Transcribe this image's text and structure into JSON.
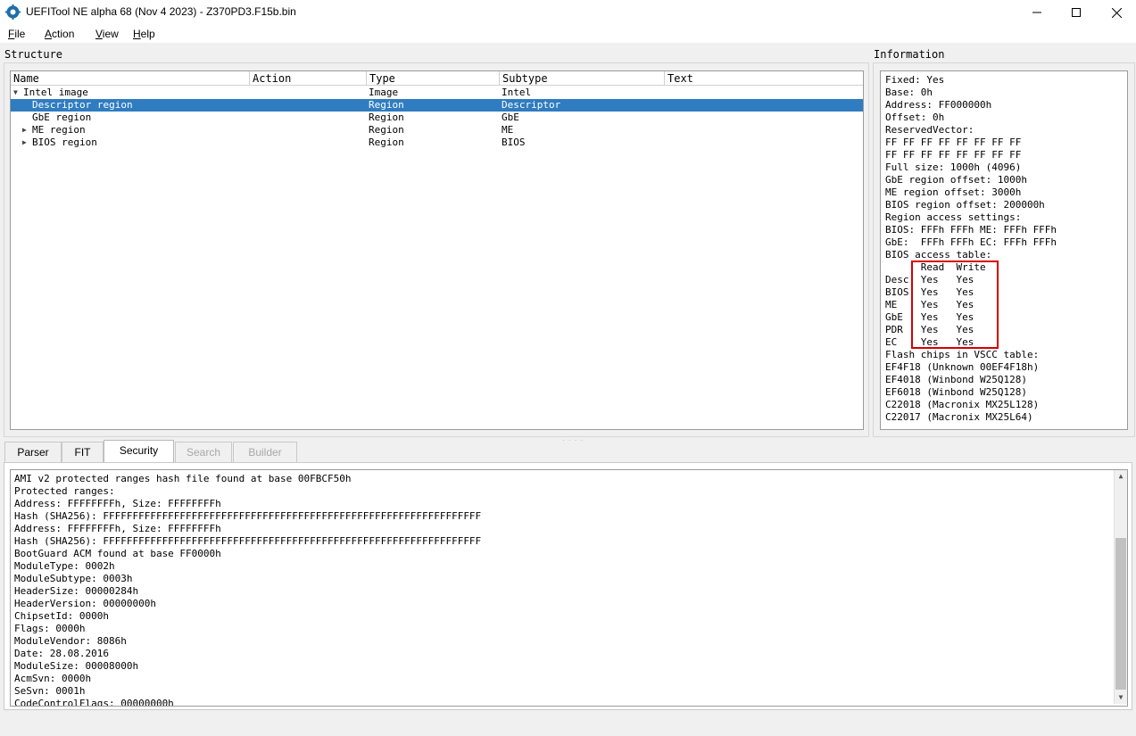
{
  "window": {
    "title": "UEFITool NE alpha 68 (Nov  4 2023) - Z370PD3.F15b.bin",
    "minimize": "—",
    "maximize": "☐",
    "close": "✕"
  },
  "menu": [
    {
      "key": "F",
      "rest": "ile"
    },
    {
      "key": "A",
      "rest": "ction"
    },
    {
      "key": "V",
      "rest": "iew"
    },
    {
      "key": "H",
      "rest": "elp"
    }
  ],
  "structure": {
    "label": "Structure",
    "columns": [
      "Name",
      "Action",
      "Type",
      "Subtype",
      "Text"
    ],
    "rows": [
      {
        "name": "Intel image",
        "action": "",
        "type": "Image",
        "subtype": "Intel",
        "text": "",
        "expander": "▼",
        "selected": false
      },
      {
        "name": "Descriptor region",
        "action": "",
        "type": "Region",
        "subtype": "Descriptor",
        "text": "",
        "expander": "",
        "selected": true
      },
      {
        "name": "GbE region",
        "action": "",
        "type": "Region",
        "subtype": "GbE",
        "text": "",
        "expander": "",
        "selected": false
      },
      {
        "name": "ME region",
        "action": "",
        "type": "Region",
        "subtype": "ME",
        "text": "",
        "expander": "▶",
        "selected": false
      },
      {
        "name": "BIOS region",
        "action": "",
        "type": "Region",
        "subtype": "BIOS",
        "text": "",
        "expander": "▶",
        "selected": false
      }
    ]
  },
  "information": {
    "label": "Information",
    "lines": [
      "Fixed: Yes",
      "Base: 0h",
      "Address: FF000000h",
      "Offset: 0h",
      "ReservedVector:",
      "FF FF FF FF FF FF FF FF",
      "FF FF FF FF FF FF FF FF",
      "Full size: 1000h (4096)",
      "GbE region offset: 1000h",
      "ME region offset: 3000h",
      "BIOS region offset: 200000h",
      "Region access settings:",
      "BIOS: FFFh FFFh ME: FFFh FFFh",
      "GbE:  FFFh FFFh EC: FFFh FFFh",
      "BIOS access table:",
      "      Read  Write",
      "Desc  Yes   Yes",
      "BIOS  Yes   Yes",
      "ME    Yes   Yes",
      "GbE   Yes   Yes",
      "PDR   Yes   Yes",
      "EC    Yes   Yes",
      "Flash chips in VSCC table:",
      "EF4F18 (Unknown 00EF4F18h)",
      "EF4018 (Winbond W25Q128)",
      "EF6018 (Winbond W25Q128)",
      "C22018 (Macronix MX25L128)",
      "C22017 (Macronix MX25L64)"
    ]
  },
  "tabs": [
    {
      "label": "Parser",
      "state": "normal"
    },
    {
      "label": "FIT",
      "state": "normal"
    },
    {
      "label": "Security",
      "state": "active"
    },
    {
      "label": "Search",
      "state": "disabled"
    },
    {
      "label": "Builder",
      "state": "disabled"
    }
  ],
  "messages": [
    "AMI v2 protected ranges hash file found at base 00FBCF50h",
    "Protected ranges:",
    "Address: FFFFFFFFh, Size: FFFFFFFFh",
    "Hash (SHA256): FFFFFFFFFFFFFFFFFFFFFFFFFFFFFFFFFFFFFFFFFFFFFFFFFFFFFFFFFFFFFFFF",
    "Address: FFFFFFFFh, Size: FFFFFFFFh",
    "Hash (SHA256): FFFFFFFFFFFFFFFFFFFFFFFFFFFFFFFFFFFFFFFFFFFFFFFFFFFFFFFFFFFFFFFF",
    "BootGuard ACM found at base FF0000h",
    "ModuleType: 0002h",
    "ModuleSubtype: 0003h",
    "HeaderSize: 00000284h",
    "HeaderVersion: 00000000h",
    "ChipsetId: 0000h",
    "Flags: 0000h",
    "ModuleVendor: 8086h",
    "Date: 28.08.2016",
    "ModuleSize: 00008000h",
    "AcmSvn: 0000h",
    "SeSvn: 0001h",
    "CodeControlFlags: 00000000h"
  ],
  "colors": {
    "selection": "#2f7cc1",
    "highlight_box": "#d40000"
  }
}
